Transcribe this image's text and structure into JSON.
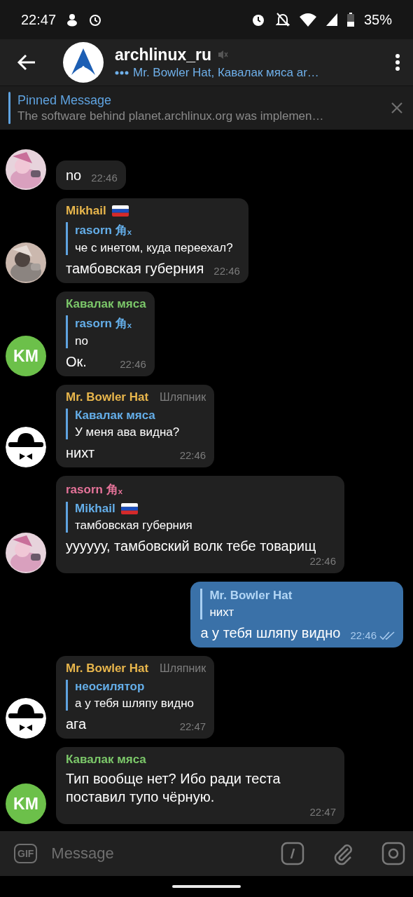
{
  "status_bar": {
    "time": "22:47",
    "battery": "35%"
  },
  "header": {
    "title": "archlinux_ru",
    "muted": true,
    "subtitle": "Mr. Bowler Hat, Кавалак мяса ar…"
  },
  "pinned": {
    "title": "Pinned Message",
    "text": "The software behind planet.archlinux.org was implemen…"
  },
  "messages": [
    {
      "kind": "incoming",
      "text": "no",
      "time": "22:46"
    },
    {
      "kind": "incoming",
      "sender": {
        "name": "Mikhail",
        "color": "#e8b64c",
        "flag": true
      },
      "reply": {
        "name": "rasorn 角ₓ",
        "text": "че с инетом, куда переехал?"
      },
      "text": "тамбовская губерния",
      "time": "22:46"
    },
    {
      "kind": "incoming",
      "avatar": {
        "kind": "initials",
        "initials": "KM",
        "color": "#6cc04a"
      },
      "sender": {
        "name": "Кавалак мяса",
        "color": "#7cc86a"
      },
      "reply": {
        "name": "rasorn 角ₓ",
        "text": "no"
      },
      "text": "Ок.",
      "time": "22:46"
    },
    {
      "kind": "incoming",
      "avatar": {
        "kind": "hat"
      },
      "sender": {
        "name": "Mr. Bowler Hat",
        "color": "#e8b64c",
        "badge": "Шляпник"
      },
      "reply": {
        "name": "Кавалак мяса",
        "text": "У меня ава видна?"
      },
      "text": "нихт",
      "time": "22:46"
    },
    {
      "kind": "incoming",
      "sender": {
        "name": "rasorn 角ₓ",
        "color": "#e57399"
      },
      "reply": {
        "name": "Mikhail",
        "flag": true,
        "text": "тамбовская губерния"
      },
      "text": "уууууу, тамбовский волк тебе товарищ",
      "time": "22:46"
    },
    {
      "kind": "outgoing",
      "reply": {
        "name": "Mr. Bowler Hat",
        "text": "нихт"
      },
      "text": "а у тебя шляпу видно",
      "time": "22:46",
      "read": true
    },
    {
      "kind": "incoming",
      "avatar": {
        "kind": "hat"
      },
      "sender": {
        "name": "Mr. Bowler Hat",
        "color": "#e8b64c",
        "badge": "Шляпник"
      },
      "reply": {
        "name": "неосилятор",
        "text": "а у тебя шляпу видно"
      },
      "text": "ага",
      "time": "22:47"
    },
    {
      "kind": "incoming",
      "avatar": {
        "kind": "initials",
        "initials": "KM",
        "color": "#6cc04a"
      },
      "sender": {
        "name": "Кавалак мяса",
        "color": "#7cc86a"
      },
      "text": "Тип вообще нет? Ибо ради теста поставил тупо чёрную.",
      "time": "22:47"
    }
  ],
  "composer": {
    "gif_label": "GIF",
    "placeholder": "Message"
  }
}
